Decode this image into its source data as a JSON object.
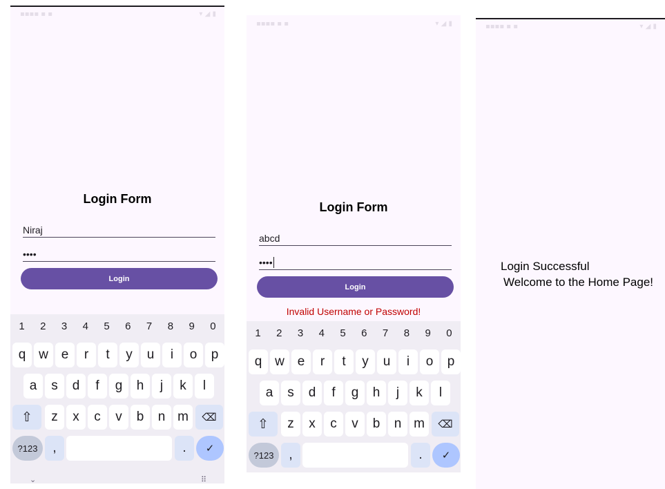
{
  "screens": [
    {
      "form_title": "Login Form",
      "username": "Niraj",
      "password": "••••",
      "login_label": "Login"
    },
    {
      "form_title": "Login Form",
      "username": "abcd",
      "password": "••••",
      "login_label": "Login",
      "error": "Invalid Username or Password!"
    },
    {
      "message_line1": "Login Successful",
      "message_line2": "Welcome to the Home Page!"
    }
  ],
  "keyboard": {
    "numbers": [
      "1",
      "2",
      "3",
      "4",
      "5",
      "6",
      "7",
      "8",
      "9",
      "0"
    ],
    "row1": [
      "q",
      "w",
      "e",
      "r",
      "t",
      "y",
      "u",
      "i",
      "o",
      "p"
    ],
    "row2": [
      "a",
      "s",
      "d",
      "f",
      "g",
      "h",
      "j",
      "k",
      "l"
    ],
    "row3": [
      "z",
      "x",
      "c",
      "v",
      "b",
      "n",
      "m"
    ],
    "sym_label": "?123",
    "comma": ",",
    "period": ".",
    "shift_icon": "shift-icon",
    "backspace_icon": "backspace-icon",
    "enter_icon": "check-icon"
  },
  "colors": {
    "background": "#fdf7ff",
    "primary": "#6750a4",
    "error": "#c00000",
    "keyboard": "#f0edf4"
  }
}
